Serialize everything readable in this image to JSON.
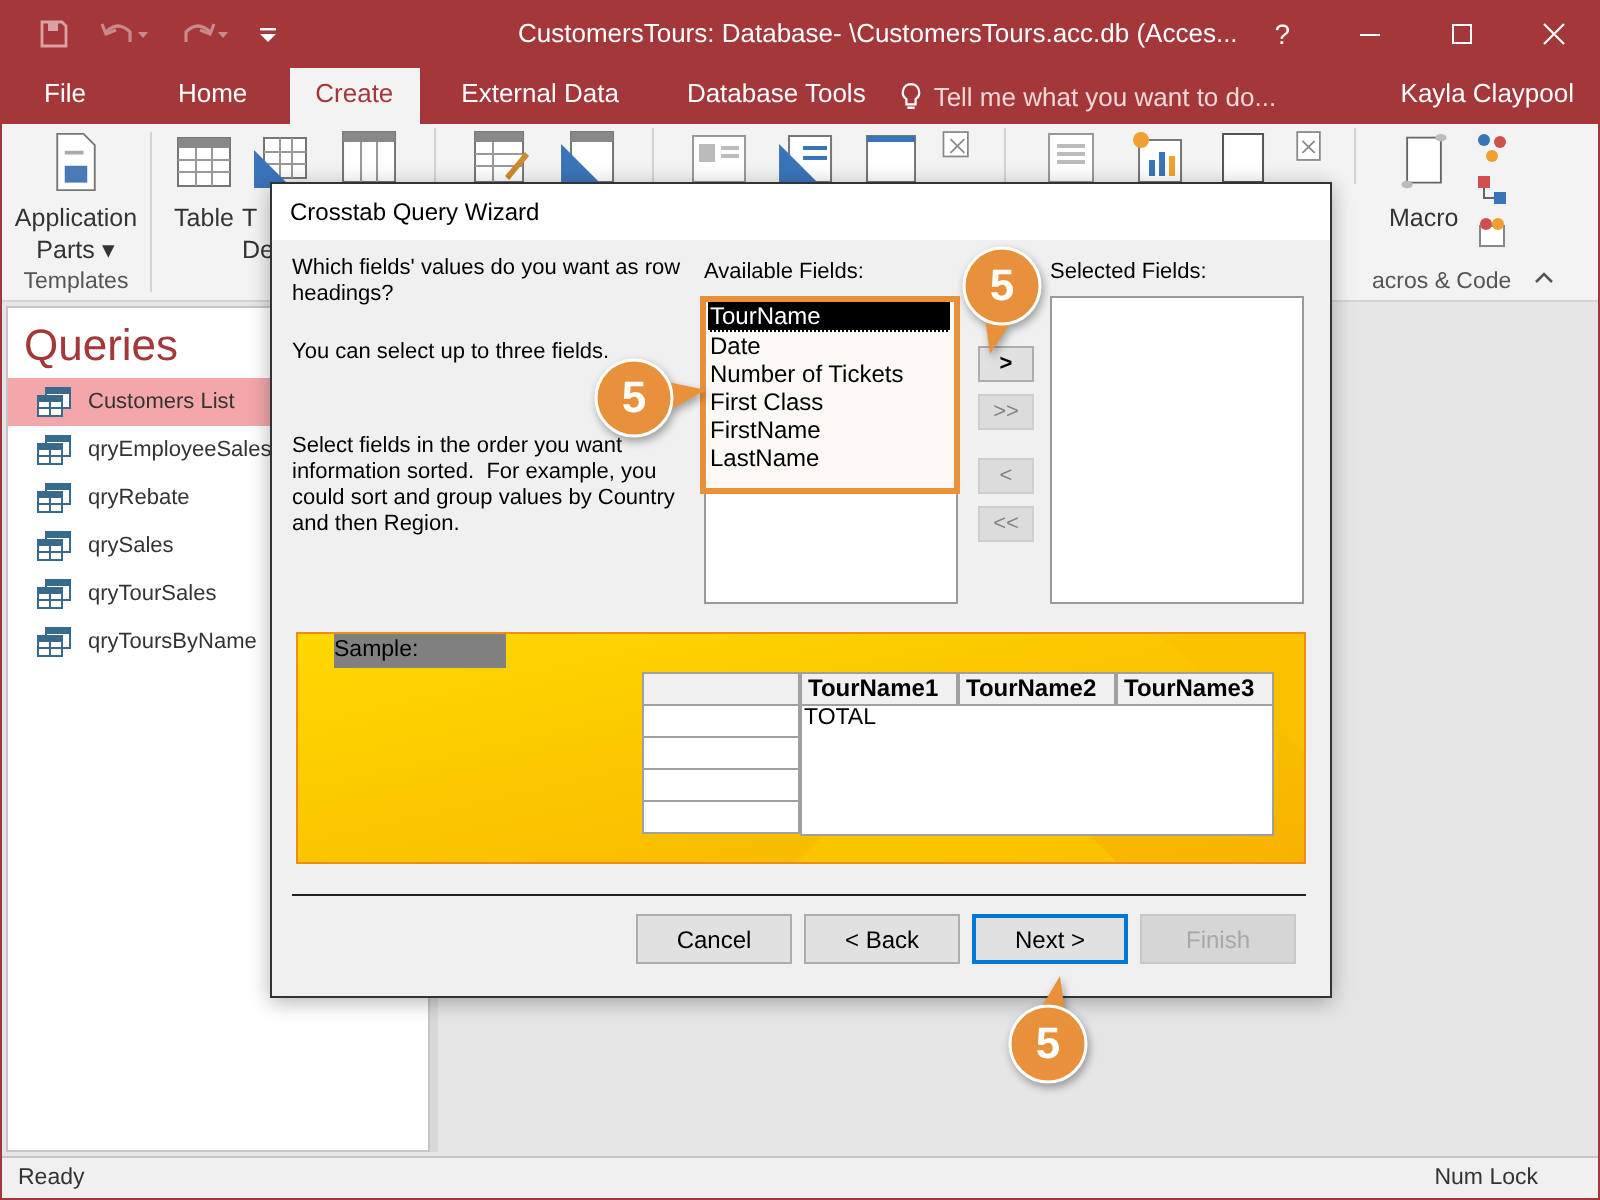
{
  "window": {
    "title": "CustomersTours: Database- \\CustomersTours.acc.db (Acces...",
    "help": "?"
  },
  "tabs": [
    {
      "label": "File",
      "selected": false
    },
    {
      "label": "Home",
      "selected": false
    },
    {
      "label": "Create",
      "selected": true
    },
    {
      "label": "External Data",
      "selected": false
    },
    {
      "label": "Database Tools",
      "selected": false
    }
  ],
  "tell_me": {
    "placeholder": "Tell me what you want to do..."
  },
  "user": "Kayla Claypool",
  "ribbon": {
    "application_parts": [
      "Application",
      "Parts ▾"
    ],
    "templates_label": "Templates",
    "table": "Table",
    "table_design": [
      "T",
      "De"
    ],
    "macro": "Macro",
    "macros_label": "acros & Code"
  },
  "nav": {
    "header": "Queries",
    "items": [
      {
        "label": "Customers List",
        "selected": true
      },
      {
        "label": "qryEmployeeSales",
        "selected": false
      },
      {
        "label": "qryRebate",
        "selected": false
      },
      {
        "label": "qrySales",
        "selected": false
      },
      {
        "label": "qryTourSales",
        "selected": false
      },
      {
        "label": "qryToursByName",
        "selected": false
      }
    ]
  },
  "dialog": {
    "title": "Crosstab Query Wizard",
    "prompt": "Which fields' values do you want as row headings?",
    "limit_note": "You can select up to three fields.",
    "order_note": "Select fields in the order you want information sorted.  For example, you could sort and group values by Country and then Region.",
    "available_label": "Available Fields:",
    "available": [
      {
        "label": "TourName",
        "selected": true
      },
      {
        "label": "Date",
        "selected": false
      },
      {
        "label": "Number of Tickets",
        "selected": false
      },
      {
        "label": "First Class",
        "selected": false
      },
      {
        "label": "FirstName",
        "selected": false
      },
      {
        "label": "LastName",
        "selected": false
      }
    ],
    "move_buttons": [
      {
        "label": ">",
        "disabled": false
      },
      {
        "label": ">>",
        "disabled": true
      },
      {
        "label": "<",
        "disabled": true
      },
      {
        "label": "<<",
        "disabled": true
      }
    ],
    "selected_label": "Selected Fields:",
    "sample": {
      "label": "Sample:",
      "columns": [
        "TourName1",
        "TourName2",
        "TourName3"
      ],
      "total": "TOTAL"
    },
    "buttons": [
      {
        "label": "Cancel",
        "disabled": false,
        "focused": false
      },
      {
        "label": "< Back",
        "disabled": false,
        "focused": false
      },
      {
        "label": "Next >",
        "disabled": false,
        "focused": true
      },
      {
        "label": "Finish",
        "disabled": true,
        "focused": false
      }
    ]
  },
  "callouts": [
    {
      "text": "5"
    },
    {
      "text": "5"
    },
    {
      "text": "5"
    }
  ],
  "status_bar": {
    "left": "Ready",
    "right": "Num Lock"
  }
}
